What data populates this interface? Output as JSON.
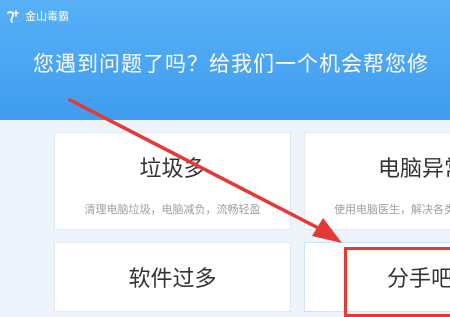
{
  "app": {
    "name": "金山毒霸"
  },
  "banner": {
    "headline": "您遇到问题了吗？给我们一个机会帮您修"
  },
  "cards": [
    {
      "title": "垃圾多",
      "desc": "清理电脑垃圾，电脑减负，流畅轻盈"
    },
    {
      "title": "电脑异常",
      "desc": "使用电脑医生，解决各类问题"
    },
    {
      "title": "软件过多",
      "desc": ""
    },
    {
      "title": "分手吧",
      "desc": ""
    }
  ],
  "colors": {
    "header": "#3f9cef",
    "card_bg": "#ffffff",
    "annotation": "#e53935"
  },
  "icons": {
    "brand": "kingsoft-logo-icon"
  }
}
